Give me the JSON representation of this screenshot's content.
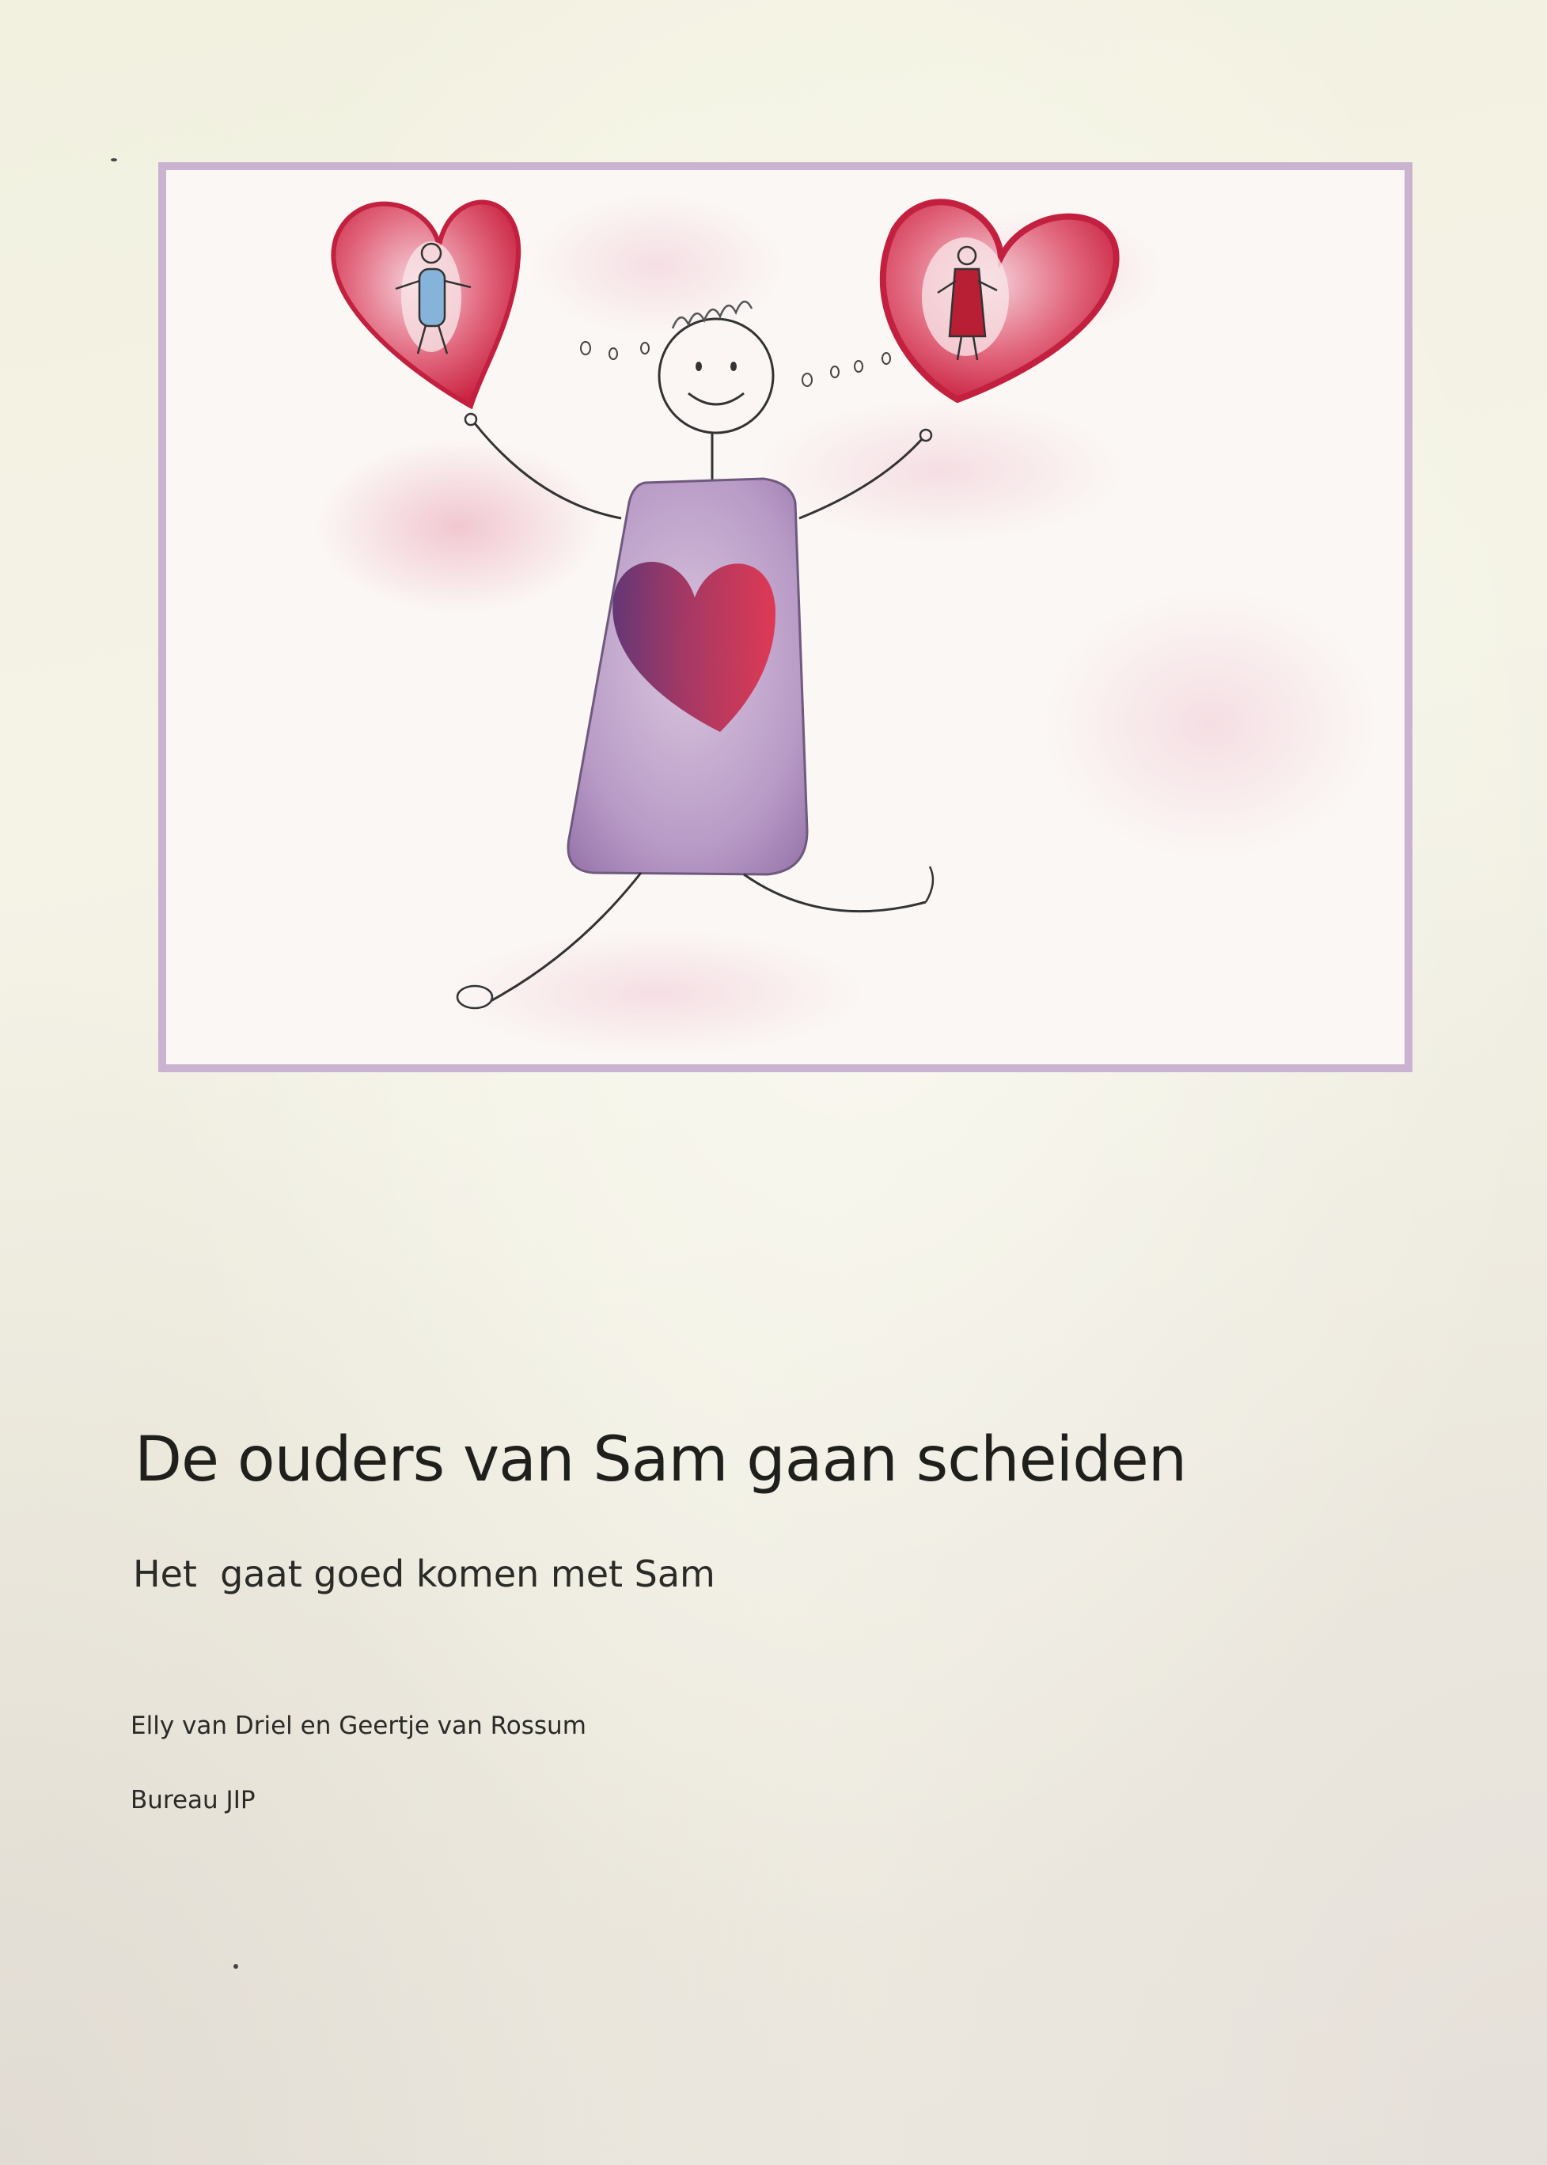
{
  "cover": {
    "title": "De ouders van Sam gaan scheiden",
    "subtitle": "Het  gaat goed komen met Sam",
    "authors": "Elly van Driel en Geertje van Rossum",
    "publisher": "Bureau JIP"
  },
  "illustration": {
    "border_color": "#c9b3d0",
    "heart_color": "#d8324b",
    "body_color": "#b49ac4"
  }
}
